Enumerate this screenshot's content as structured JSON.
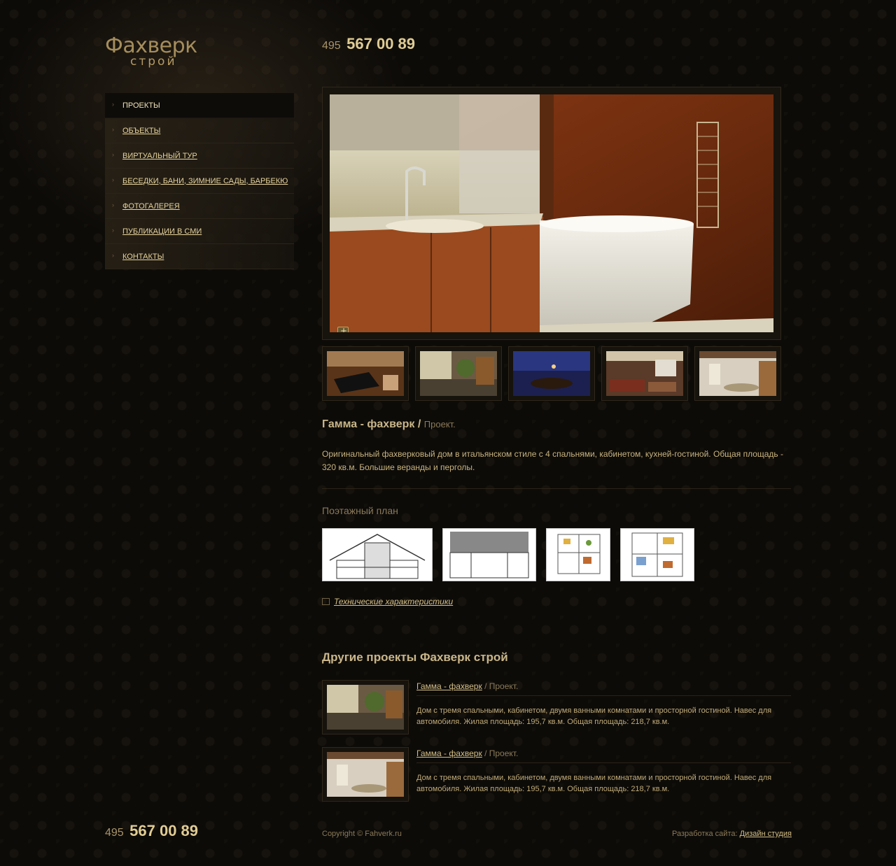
{
  "brand": {
    "name": "Фахверк",
    "sub": "строй"
  },
  "phone": {
    "code": "495",
    "number": "567 00 89"
  },
  "nav": [
    {
      "label": "Проекты",
      "active": true
    },
    {
      "label": "Объекты"
    },
    {
      "label": "Виртуальный тур"
    },
    {
      "label": "Беседки, бани, зимние сады, барбекю"
    },
    {
      "label": "Фотогалерея"
    },
    {
      "label": "Публикации в СМИ"
    },
    {
      "label": "Контакты"
    }
  ],
  "project": {
    "title": "Гамма - фахверк /",
    "type": "Проект.",
    "description": "Оригинальный фахверковый дом в итальянском стиле с 4 спальнями, кабинетом, кухней-гостиной. Общая площадь - 320 кв.м. Большие веранды и перголы."
  },
  "floor_plan": {
    "heading": "Поэтажный план"
  },
  "tech_link": "Технические характеристики",
  "others": {
    "heading": "Другие проекты Фахверк строй",
    "items": [
      {
        "title": "Гамма - фахверк",
        "type": "Проект.",
        "description": "Дом с тремя спальными, кабинетом, двумя ванными комнатами и просторной гостиной. Навес для автомобиля. Жилая площадь: 195,7 кв.м. Общая площадь: 218,7 кв.м."
      },
      {
        "title": "Гамма - фахверк",
        "type": "Проект.",
        "description": "Дом с тремя спальными, кабинетом, двумя ванными комнатами и просторной гостиной. Навес для автомобиля. Жилая площадь: 195,7 кв.м. Общая площадь: 218,7 кв.м."
      }
    ]
  },
  "footer": {
    "copyright": "Copyright © Fahverk.ru",
    "dev_label": "Разработка сайта:",
    "dev_link": "Дизайн студия"
  }
}
